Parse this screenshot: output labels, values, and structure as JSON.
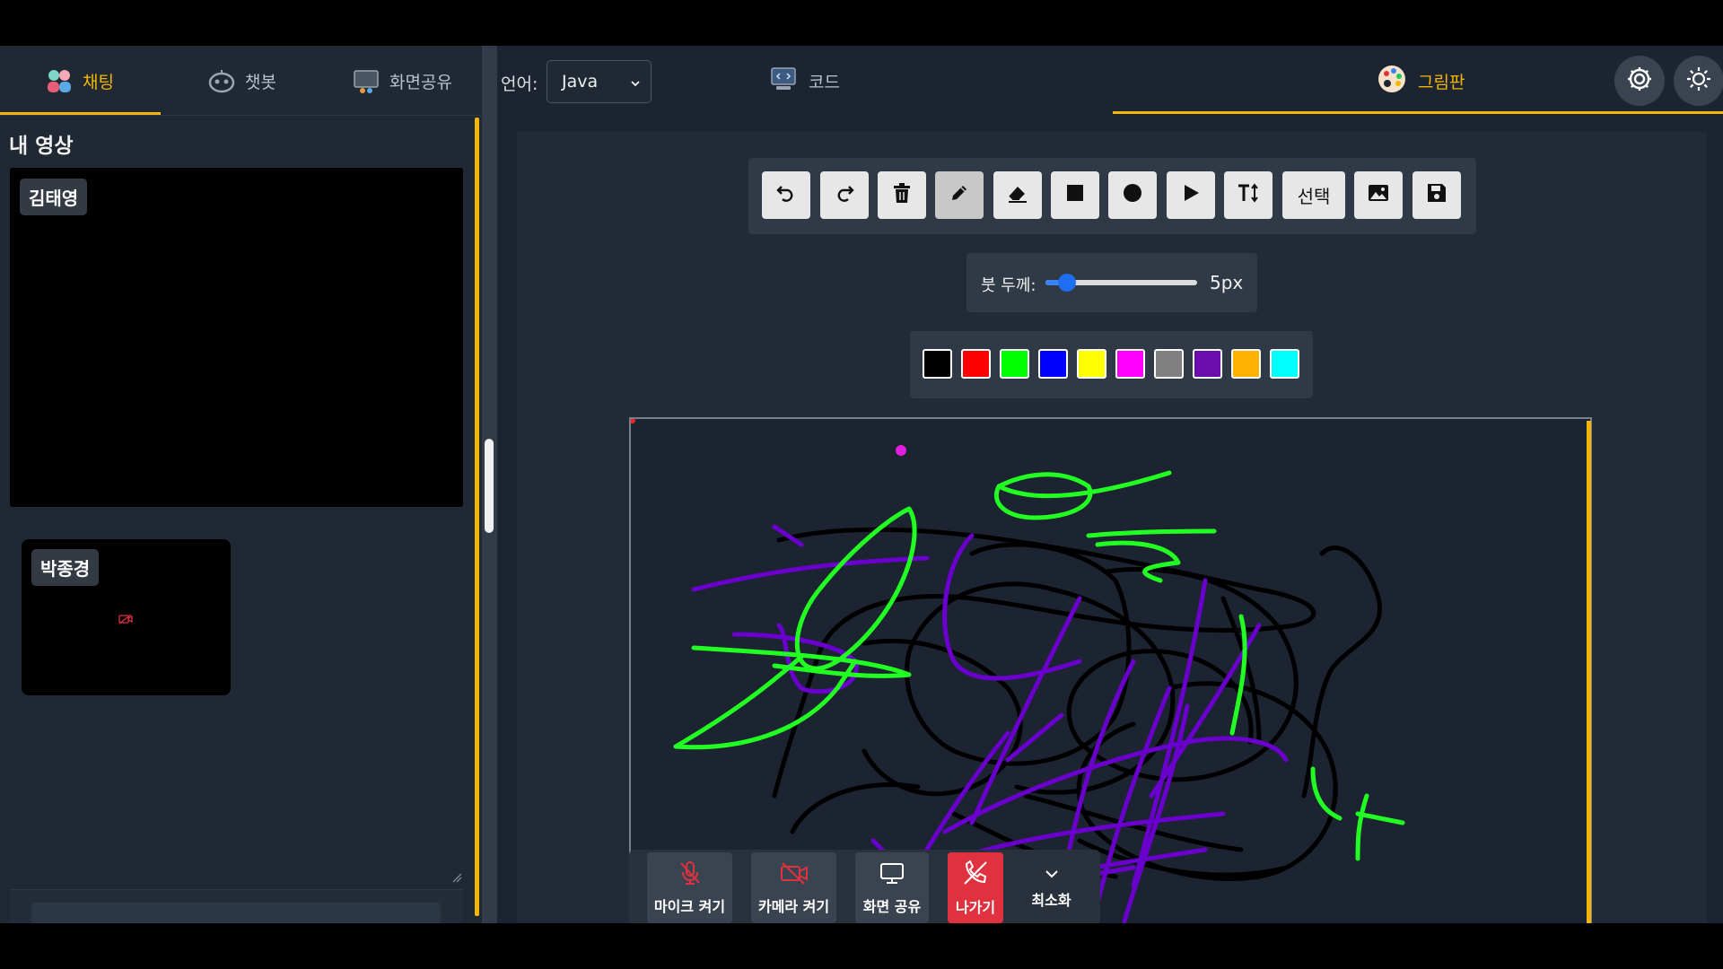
{
  "left_tabs": [
    {
      "label": "채팅",
      "icon": "people-icon",
      "active": true
    },
    {
      "label": "챗봇",
      "icon": "robot-icon",
      "active": false
    },
    {
      "label": "화면공유",
      "icon": "screen-share-icon",
      "active": false
    }
  ],
  "my_video": {
    "title": "내 영상",
    "main_participant": "김태영",
    "secondary_participant": "박종경"
  },
  "editor": {
    "language_label": "언어:",
    "language_value": "Java"
  },
  "right_tabs": [
    {
      "label": "코드",
      "icon": "code-monitor-icon",
      "active": false
    },
    {
      "label": "그림판",
      "icon": "palette-icon",
      "active": true
    }
  ],
  "toolbar": {
    "tools": [
      "undo-icon",
      "redo-icon",
      "trash-icon",
      "pencil-icon",
      "eraser-icon",
      "square-icon",
      "circle-icon",
      "triangle-icon",
      "text-icon",
      "select",
      "image-icon",
      "save-icon"
    ],
    "select_label": "선택",
    "active_tool": "pencil-icon"
  },
  "brush": {
    "label": "붓 두께:",
    "value_text": "5px",
    "level": 0.12
  },
  "palette": [
    "#000000",
    "#ff0000",
    "#00ff00",
    "#0000ff",
    "#ffff00",
    "#ff00ff",
    "#808080",
    "#6a0dad",
    "#ffb300",
    "#00ffff"
  ],
  "colors": {
    "accent": "#f2b705",
    "danger": "#e0313f",
    "stroke_black": "#000000",
    "stroke_green": "#22ff22",
    "stroke_purple": "#6a00cc"
  },
  "controls": {
    "mic_label": "마이크 켜기",
    "camera_label": "카메라 켜기",
    "screen_share_label": "화면 공유",
    "leave_label": "나가기",
    "minimize_label": "최소화"
  }
}
